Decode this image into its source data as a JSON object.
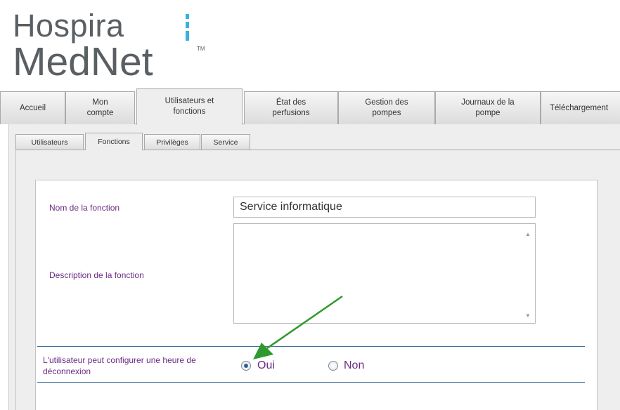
{
  "logo": {
    "line1": "Hospira",
    "line2": "MedNet",
    "tm": "TM"
  },
  "main_tabs": [
    {
      "label": "Accueil"
    },
    {
      "label": "Mon\ncompte"
    },
    {
      "label": "Utilisateurs et\nfonctions",
      "active": true
    },
    {
      "label": "État des\nperfusions"
    },
    {
      "label": "Gestion des\npompes"
    },
    {
      "label": "Journaux de la\npompe"
    },
    {
      "label": "Téléchargement"
    }
  ],
  "sub_tabs": [
    {
      "label": "Utilisateurs"
    },
    {
      "label": "Fonctions",
      "active": true
    },
    {
      "label": "Privilèges"
    },
    {
      "label": "Service"
    }
  ],
  "form": {
    "name_label": "Nom de la fonction",
    "name_value": "Service informatique",
    "description_label": "Description de la fonction",
    "description_value": "",
    "logout_label": "L'utilisateur peut configurer une heure de\ndéconnexion",
    "option_yes": "Oui",
    "option_no": "Non",
    "selected": "Oui"
  },
  "colors": {
    "label_purple": "#6a2b83",
    "arrow_green": "#2e9a2e",
    "logo_blue": "#3ab0e2",
    "divider_blue": "#3d6f9c"
  }
}
